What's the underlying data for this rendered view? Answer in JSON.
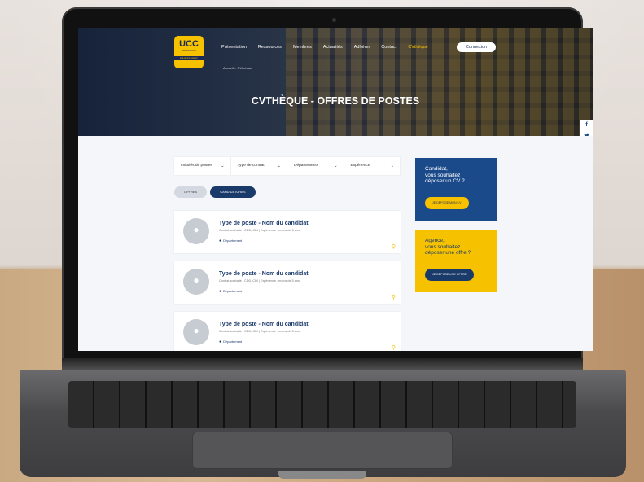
{
  "header": {
    "logo_main": "UCC",
    "logo_sub": "GRAND SUD",
    "logo_tag": "ENSEMBLE",
    "nav": [
      "Présentation",
      "Ressources",
      "Membres",
      "Actualités",
      "Adhérer",
      "Contact",
      "CVthèque"
    ],
    "active_nav": "CVthèque",
    "connect_label": "Connexion",
    "breadcrumb": "Accueil > CVthèque",
    "title": "CVTHÈQUE - OFFRES DE POSTES"
  },
  "social": [
    "f",
    "t",
    "in"
  ],
  "filters": [
    {
      "label": "Intitulés de postes"
    },
    {
      "label": "Type de contrat"
    },
    {
      "label": "Départements"
    },
    {
      "label": "Expérience"
    }
  ],
  "tabs": [
    {
      "label": "OFFRES",
      "active": false
    },
    {
      "label": "CANDIDATURES",
      "active": true
    }
  ],
  "cards": [
    {
      "title": "Type de poste - Nom du candidat",
      "meta": "Contrat souhaité : CDD, CDI  |  Expérience : moins de 5 ans",
      "location": "Département"
    },
    {
      "title": "Type de poste - Nom du candidat",
      "meta": "Contrat souhaité : CDD, CDI  |  Expérience : moins de 5 ans",
      "location": "Département"
    },
    {
      "title": "Type de poste - Nom du candidat",
      "meta": "Contrat souhaité : CDD, CDI  |  Expérience : moins de 5 ans",
      "location": "Département"
    }
  ],
  "cta_candidate": {
    "text": "Candidat,\nvous souhaitez\ndéposer un CV ?",
    "button": "JE DÉPOSE MON CV"
  },
  "cta_agency": {
    "text": "Agence,\nvous souhaitez\ndéposer une offre ?",
    "button": "JE DÉPOSE UNE OFFRE"
  },
  "colors": {
    "brand_yellow": "#f6c200",
    "brand_blue": "#1a3a6a"
  }
}
